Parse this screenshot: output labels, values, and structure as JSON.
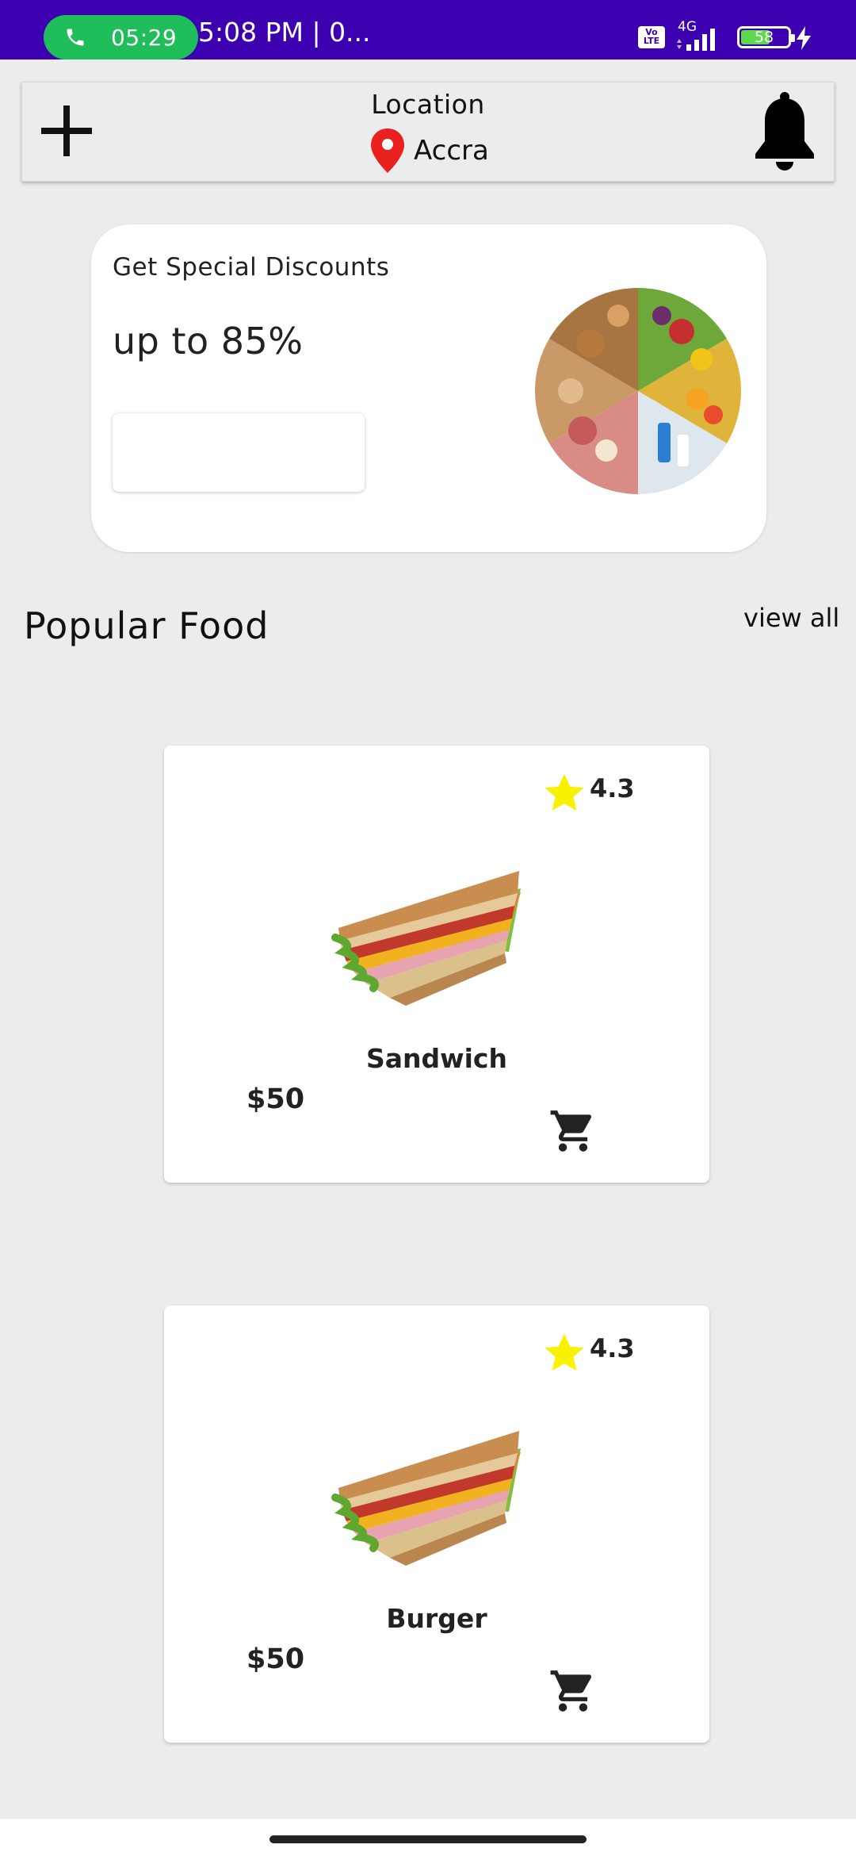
{
  "status_bar": {
    "call_timer": "05:29",
    "time_text": "5:08 PM | 0...",
    "volte": "Vo LTE",
    "network": "4G",
    "battery_level": "58",
    "battery_fraction": 0.58,
    "icons": [
      "phone-icon",
      "signal-icon",
      "battery-icon",
      "charging-bolt-icon"
    ]
  },
  "header": {
    "location_label": "Location",
    "city": "Accra",
    "icons": [
      "plus-icon",
      "map-pin-icon",
      "bell-icon"
    ],
    "pin_color": "#e8211e"
  },
  "promo": {
    "title": "Get Special Discounts",
    "value": "up to 85%",
    "button_label": ""
  },
  "popular": {
    "title": "Popular Food",
    "view_all": "view all",
    "items": [
      {
        "rating": "4.3",
        "name": "Sandwich",
        "price": "$50"
      },
      {
        "rating": "4.3",
        "name": "Burger",
        "price": "$50"
      }
    ]
  },
  "colors": {
    "status_bar": "#3c00b0",
    "call_pill": "#1fbe5b",
    "background": "#ebecee",
    "star": "#f7f300"
  }
}
